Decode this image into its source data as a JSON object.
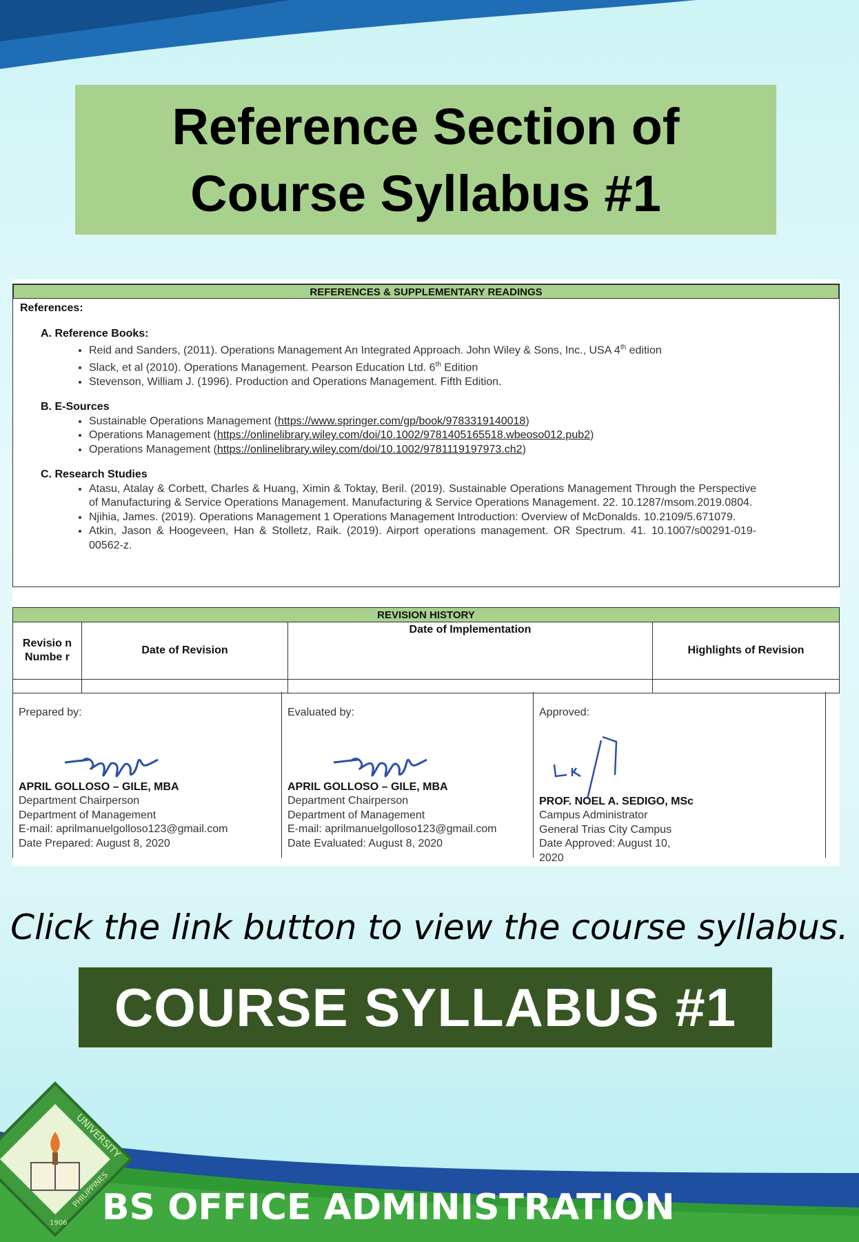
{
  "title": {
    "line1": "Reference Section of",
    "line2": "Course Syllabus #1"
  },
  "references": {
    "header": "REFERENCES & SUPPLEMENTARY READINGS",
    "label": "References:",
    "groups": [
      {
        "title": "A.  Reference Books:",
        "items": [
          "Reid and Sanders, (2011). Operations Management An Integrated Approach. John Wiley & Sons, Inc., USA 4th edition",
          "Slack, et al (2010). Operations Management. Pearson Education Ltd. 6th Edition",
          "Stevenson, William J. (1996). Production and Operations Management. Fifth Edition."
        ]
      },
      {
        "title": "B.  E-Sources",
        "items": [
          {
            "text": "Sustainable Operations Management",
            "link": "https://www.springer.com/gp/book/9783319140018"
          },
          {
            "text": "Operations Management",
            "link": "https://onlinelibrary.wiley.com/doi/10.1002/9781405165518.wbeoso012.pub2"
          },
          {
            "text": "Operations Management",
            "link": "https://onlinelibrary.wiley.com/doi/10.1002/9781119197973.ch2"
          }
        ]
      },
      {
        "title": "C.  Research Studies",
        "items": [
          "Atasu, Atalay & Corbett, Charles & Huang, Ximin & Toktay, Beril. (2019). Sustainable Operations Management Through the Perspective of Manufacturing & Service Operations Management. Manufacturing & Service Operations Management. 22. 10.1287/msom.2019.0804.",
          "Njihia, James. (2019). Operations Management 1 Operations Management Introduction: Overview of McDonalds. 10.2109/5.671079.",
          "Atkin, Jason & Hoogeveen, Han & Stolletz, Raik. (2019). Airport operations management. OR Spectrum. 41. 10.1007/s00291-019-00562-z."
        ]
      }
    ]
  },
  "revision": {
    "header": "REVISION HISTORY",
    "columns": [
      "Revisio n Numbe r",
      "Date of Revision",
      "Date of Implementation",
      "Highlights of Revision"
    ]
  },
  "signatories": [
    {
      "role": "Prepared by:",
      "name": "APRIL GOLLOSO – GILE, MBA",
      "lines": [
        "Department Chairperson",
        "Department of Management",
        "E-mail: aprilmanuelgolloso123@gmail.com",
        "Date Prepared: August 8, 2020"
      ]
    },
    {
      "role": "Evaluated by:",
      "name": "APRIL GOLLOSO – GILE, MBA",
      "lines": [
        "Department Chairperson",
        "Department of Management",
        "E-mail: aprilmanuelgolloso123@gmail.com",
        "Date Evaluated: August 8, 2020"
      ]
    },
    {
      "role": "Approved:",
      "name": "PROF. NOEL A. SEDIGO, MSc",
      "lines": [
        "Campus Administrator",
        "General Trias City Campus",
        "Date Approved:  August 10, 2020"
      ]
    }
  ],
  "cta": {
    "text": "Click the link button to view the course syllabus.",
    "button": "COURSE SYLLABUS #1"
  },
  "footer": {
    "program": "BS OFFICE ADMINISTRATION",
    "logo_text": [
      "UNIVERSITY",
      "PHILIPPINES",
      "1906"
    ]
  },
  "colors": {
    "title_bg": "#a9d18e",
    "button_bg": "#375623",
    "footer_green": "#2f9a34",
    "footer_blue": "#1f4fa0"
  }
}
